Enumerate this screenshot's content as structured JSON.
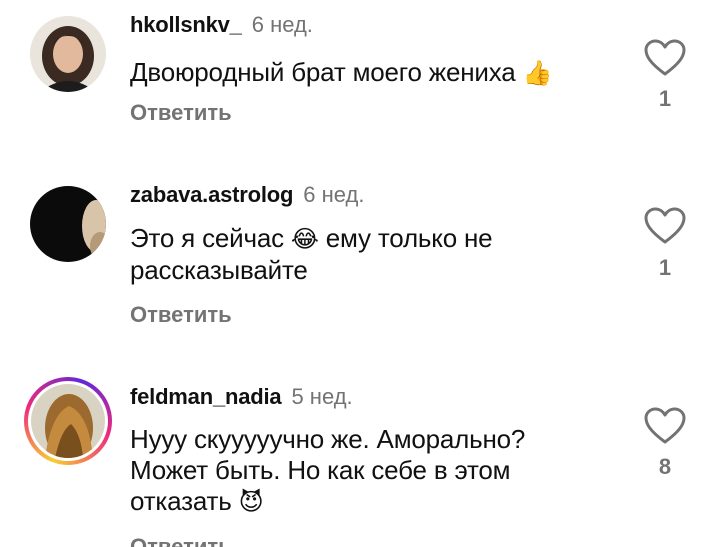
{
  "comments": [
    {
      "username": "hkollsnkv_",
      "time": "6 нед.",
      "text": "Двоюродный брат моего жениха",
      "emoji": "👍",
      "reply": "Ответить",
      "likes": "1"
    },
    {
      "username": "zabava.astrolog",
      "time": "6 нед.",
      "text_before": "Это я сейчас",
      "emoji": "😂",
      "text_after": "ему только не рассказывайте",
      "reply": "Ответить",
      "likes": "1"
    },
    {
      "username": "feldman_nadia",
      "time": "5 нед.",
      "text": "Нууу скууууучно же. Аморально? Может быть. Но как себе в этом отказать",
      "emoji": "😈",
      "reply": "Ответить",
      "likes": "8"
    }
  ],
  "colors": {
    "secondary": "#737373",
    "text": "#111111",
    "story_ring": [
      "#f9ce34",
      "#ee2a7b",
      "#6228d7"
    ]
  },
  "icons": {
    "like": "heart-outline-icon"
  }
}
